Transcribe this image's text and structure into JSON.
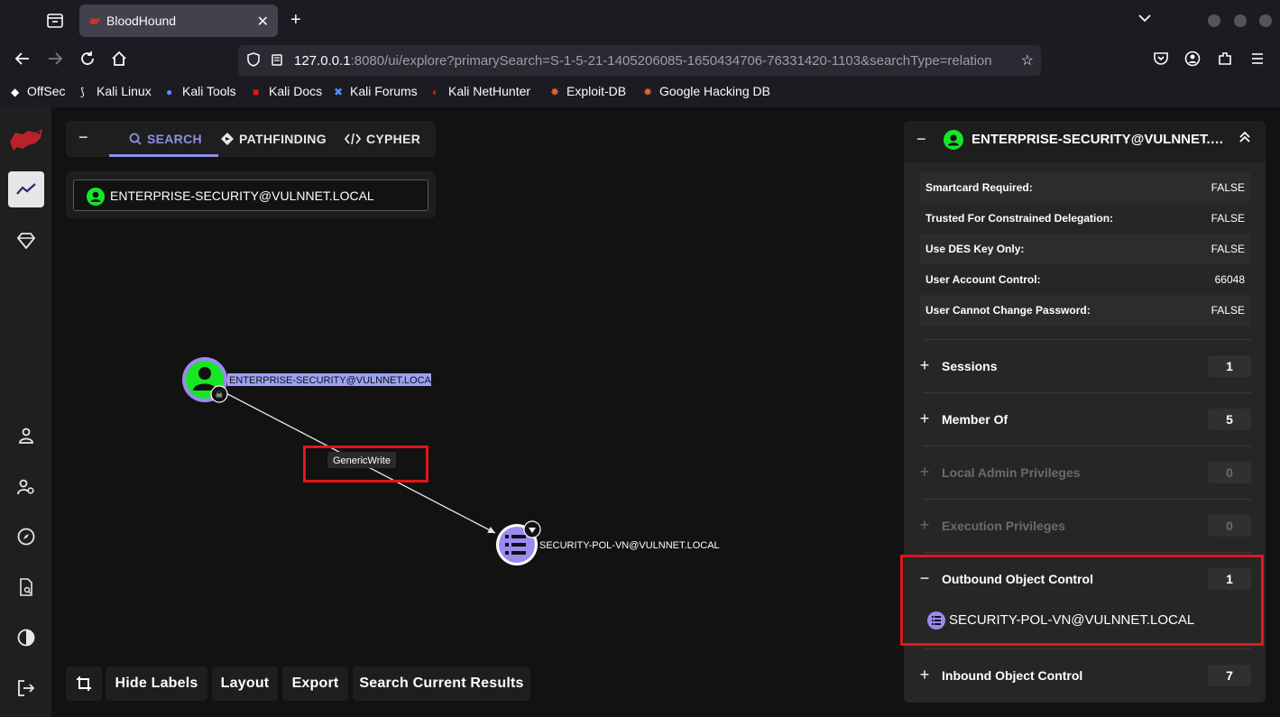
{
  "browser": {
    "tab_title": "BloodHound",
    "url_host": "127.0.0.1",
    "url_rest": ":8080/ui/explore?primarySearch=S-1-5-21-1405206085-1650434706-76331420-1103&searchType=relation",
    "bookmarks": [
      "OffSec",
      "Kali Linux",
      "Kali Tools",
      "Kali Docs",
      "Kali Forums",
      "Kali NetHunter",
      "Exploit-DB",
      "Google Hacking DB"
    ]
  },
  "search_card": {
    "tabs": [
      "SEARCH",
      "PATHFINDING",
      "CYPHER"
    ],
    "input_value": "ENTERPRISE-SECURITY@VULNNET.LOCAL"
  },
  "graph": {
    "source_label": "ENTERPRISE-SECURITY@VULNNET.LOCAL",
    "target_label": "SECURITY-POL-VN@VULNNET.LOCAL",
    "edge_label": "GenericWrite"
  },
  "bottom_toolbar": {
    "hide_labels": "Hide Labels",
    "layout": "Layout",
    "export": "Export",
    "search_results": "Search Current Results"
  },
  "panel": {
    "title": "ENTERPRISE-SECURITY@VULNNET.LOC...",
    "properties": [
      {
        "key": "Smartcard Required:",
        "value": "FALSE"
      },
      {
        "key": "Trusted For Constrained Delegation:",
        "value": "FALSE"
      },
      {
        "key": "Use DES Key Only:",
        "value": "FALSE"
      },
      {
        "key": "User Account Control:",
        "value": "66048"
      },
      {
        "key": "User Cannot Change Password:",
        "value": "FALSE"
      }
    ],
    "sections": [
      {
        "sign": "+",
        "label": "Sessions",
        "count": "1"
      },
      {
        "sign": "+",
        "label": "Member Of",
        "count": "5"
      },
      {
        "sign": "+",
        "label": "Local Admin Privileges",
        "count": "0"
      },
      {
        "sign": "+",
        "label": "Execution Privileges",
        "count": "0"
      },
      {
        "sign": "−",
        "label": "Outbound Object Control",
        "count": "1"
      },
      {
        "sign": "+",
        "label": "Inbound Object Control",
        "count": "7"
      }
    ],
    "outbound_item": "SECURITY-POL-VN@VULNNET.LOCAL"
  },
  "colors": {
    "user_node": "#17e625",
    "gpo_node": "#9b8af0",
    "accent": "#8f8fe8",
    "highlight": "#e0171a"
  }
}
